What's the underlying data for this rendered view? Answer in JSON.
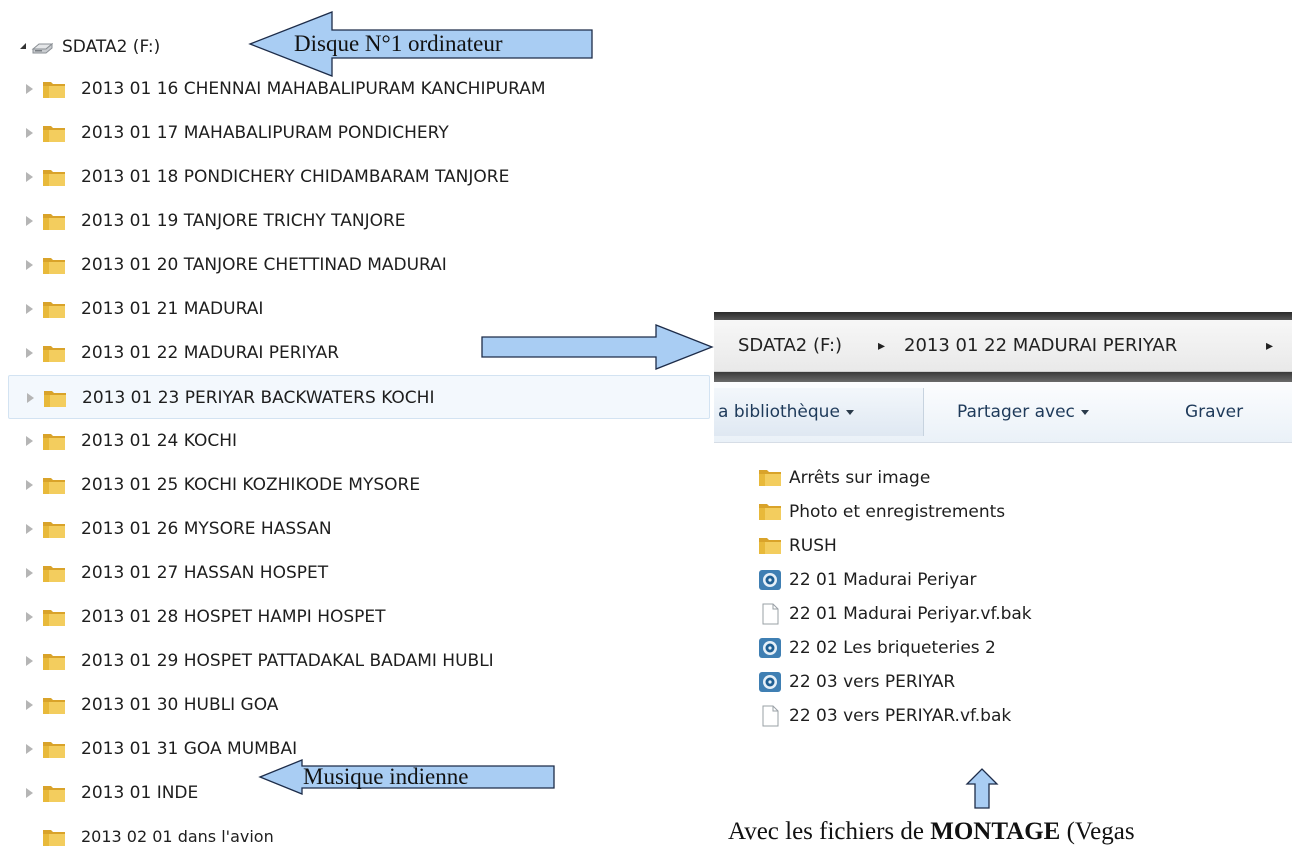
{
  "tree": {
    "drive_label": "SDATA2 (F:)",
    "items": [
      {
        "label": "2013 01 16 CHENNAI MAHABALIPURAM KANCHIPURAM"
      },
      {
        "label": "2013 01 17 MAHABALIPURAM PONDICHERY"
      },
      {
        "label": "2013 01 18 PONDICHERY CHIDAMBARAM TANJORE"
      },
      {
        "label": "2013 01 19 TANJORE TRICHY TANJORE"
      },
      {
        "label": "2013 01 20 TANJORE CHETTINAD MADURAI"
      },
      {
        "label": "2013 01 21 MADURAI"
      },
      {
        "label": "2013 01 22 MADURAI PERIYAR"
      },
      {
        "label": "2013 01 23 PERIYAR BACKWATERS KOCHI",
        "selected": true
      },
      {
        "label": "2013 01 24 KOCHI"
      },
      {
        "label": "2013 01 25 KOCHI KOZHIKODE MYSORE"
      },
      {
        "label": "2013 01 26 MYSORE HASSAN"
      },
      {
        "label": "2013 01 27 HASSAN HOSPET"
      },
      {
        "label": "2013 01 28 HOSPET HAMPI HOSPET"
      },
      {
        "label": "2013 01 29 HOSPET PATTADAKAL BADAMI HUBLI"
      },
      {
        "label": "2013 01 30 HUBLI GOA"
      },
      {
        "label": "2013 01 31 GOA MUMBAI"
      },
      {
        "label": "2013 01 INDE"
      },
      {
        "label": "2013 02 01 dans l'avion"
      }
    ]
  },
  "explorer": {
    "breadcrumb": {
      "drive": "SDATA2 (F:)",
      "folder": "2013 01 22 MADURAI PERIYAR",
      "separator": "▸"
    },
    "toolbar": {
      "library": "a bibliothèque",
      "share": "Partager avec",
      "burn": "Graver"
    },
    "files": [
      {
        "name": "Arrêts sur image",
        "icon": "folder-icon"
      },
      {
        "name": "Photo et enregistrements",
        "icon": "folder-icon"
      },
      {
        "name": "RUSH",
        "icon": "folder-icon"
      },
      {
        "name": "22 01 Madurai Periyar",
        "icon": "vegas-project-icon"
      },
      {
        "name": "22 01 Madurai Periyar.vf.bak",
        "icon": "blank-file-icon"
      },
      {
        "name": "22 02 Les briqueteries 2",
        "icon": "vegas-project-icon"
      },
      {
        "name": "22 03 vers PERIYAR",
        "icon": "vegas-project-icon"
      },
      {
        "name": "22 03 vers PERIYAR.vf.bak",
        "icon": "blank-file-icon"
      }
    ]
  },
  "annotations": {
    "disk": "Disque N°1 ordinateur",
    "music": "Musique indienne",
    "caption_before": "Avec les fichiers de ",
    "caption_bold": "MONTAGE",
    "caption_after": " (Vegas"
  },
  "colors": {
    "callout_fill": "#a9cdf3",
    "callout_border": "#1d2c49",
    "folder_yellow": "#e8b93a",
    "selection": "#f3f8fd"
  }
}
